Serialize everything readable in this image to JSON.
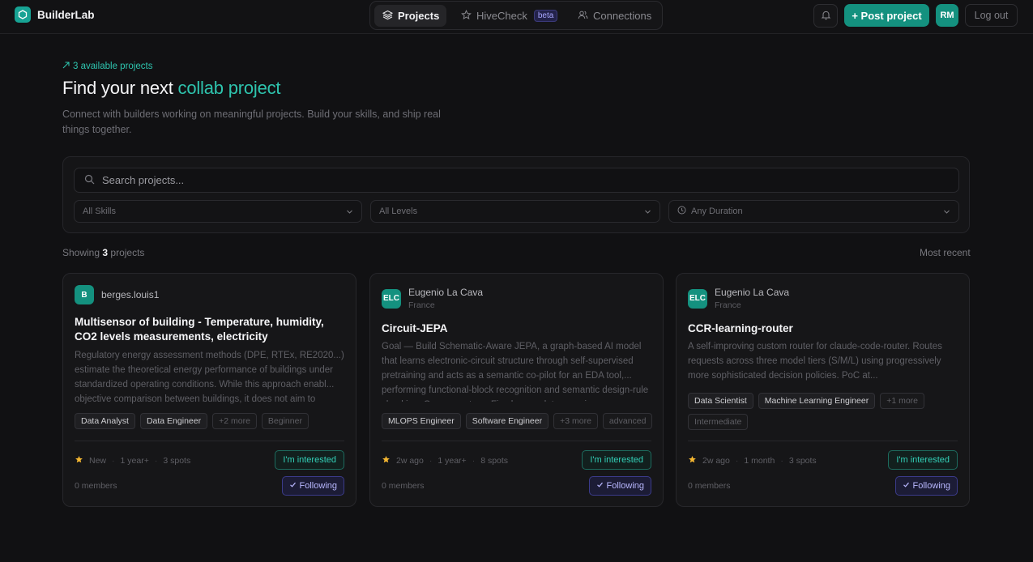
{
  "brand": {
    "name": "BuilderLab"
  },
  "nav": {
    "projects": "Projects",
    "hivecheck": "HiveCheck",
    "beta": "beta",
    "connections": "Connections"
  },
  "header": {
    "post_project": "+ Post project",
    "avatar_initials": "RM",
    "logout": "Log out"
  },
  "hero": {
    "available": "3 available projects",
    "title_prefix": "Find your next ",
    "title_accent": "collab project",
    "description": "Connect with builders working on meaningful projects. Build your skills, and ship real things together."
  },
  "filters": {
    "search_placeholder": "Search projects...",
    "skills": "All Skills",
    "levels": "All Levels",
    "duration": "Any Duration"
  },
  "results": {
    "showing_prefix": "Showing ",
    "count": "3",
    "showing_suffix": " projects",
    "sort": "Most recent"
  },
  "cards": [
    {
      "owner_initials": "B",
      "owner_name": "berges.louis1",
      "owner_location": "",
      "title": "Multisensor of building - Temperature, humidity, CO2 levels measurements, electricity",
      "description": "Regulatory energy assessment methods (DPE, RTEx, RE2020...) estimate the theoretical energy performance of buildings under standardized operating conditions. While this approach enabl... objective comparison between buildings, it does not aim to",
      "tags": [
        "Data Analyst",
        "Data Engineer"
      ],
      "more": "+2 more",
      "level": "Beginner",
      "posted": "New",
      "duration": "1 year+",
      "spots": "3 spots",
      "interest": "I'm interested",
      "members": "0 members",
      "following": "Following"
    },
    {
      "owner_initials": "ELC",
      "owner_name": "Eugenio La Cava",
      "owner_location": "France",
      "title": "Circuit-JEPA",
      "description": "Goal — Build Schematic-Aware JEPA, a graph-based AI model that learns electronic-circuit structure through self-supervised pretraining and acts as a semantic co-pilot for an EDA tool,... performing functional-block recognition and semantic design-rule checking. Components — Five layers, data sourcing",
      "tags": [
        "MLOPS Engineer",
        "Software Engineer"
      ],
      "more": "+3 more",
      "level": "advanced",
      "posted": "2w ago",
      "duration": "1 year+",
      "spots": "8 spots",
      "interest": "I'm interested",
      "members": "0 members",
      "following": "Following"
    },
    {
      "owner_initials": "ELC",
      "owner_name": "Eugenio La Cava",
      "owner_location": "France",
      "title": "CCR-learning-router",
      "description": "A self-improving custom router for claude-code-router. Routes requests across three model tiers (S/M/L) using progressively more sophisticated decision policies. PoC at...",
      "tags": [
        "Data Scientist",
        "Machine Learning Engineer"
      ],
      "more": "+1 more",
      "level": "Intermediate",
      "posted": "2w ago",
      "duration": "1 month",
      "spots": "3 spots",
      "interest": "I'm interested",
      "members": "0 members",
      "following": "Following"
    }
  ],
  "colors": {
    "accent": "#14917f",
    "accent_text": "#2ec4ae",
    "background": "#111113",
    "follow": "#b9b8ff",
    "star": "#f5b731"
  },
  "icons": [
    "hexagon-logo-icon",
    "layers-icon",
    "star-icon",
    "users-icon",
    "bell-icon",
    "trend-arrow-icon",
    "search-icon",
    "chevron-down-icon",
    "clock-icon",
    "check-icon"
  ]
}
